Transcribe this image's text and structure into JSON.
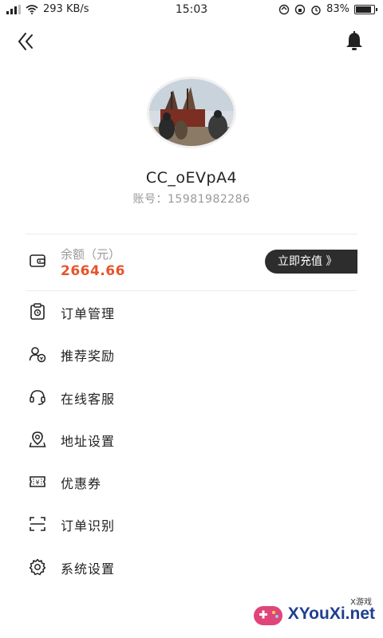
{
  "status_bar": {
    "signal_icon": "signal-icon",
    "wifi_icon": "wifi-icon",
    "speed": "293 KB/s",
    "time": "15:03",
    "battery_percent": "83%",
    "battery_level": 0.83
  },
  "top_bar": {
    "back_icon": "double-chevron-left-icon",
    "bell_icon": "bell-icon"
  },
  "profile": {
    "username": "CC_oEVpA4",
    "account": "账号：15981982286"
  },
  "balance": {
    "label": "余额（元）",
    "amount": "2664.66",
    "recharge_label": "立即充值 》",
    "amount_color": "#e8532b"
  },
  "menu": [
    {
      "label": "订单管理",
      "icon": "order-icon"
    },
    {
      "label": "推荐奖励",
      "icon": "recommend-icon"
    },
    {
      "label": "在线客服",
      "icon": "headset-icon"
    },
    {
      "label": "地址设置",
      "icon": "location-icon"
    },
    {
      "label": "优惠券",
      "icon": "coupon-icon"
    },
    {
      "label": "订单识别",
      "icon": "scan-icon"
    },
    {
      "label": "系统设置",
      "icon": "gear-icon"
    }
  ],
  "watermark": {
    "tag": "X游戏",
    "name": "XYouXi.net"
  }
}
